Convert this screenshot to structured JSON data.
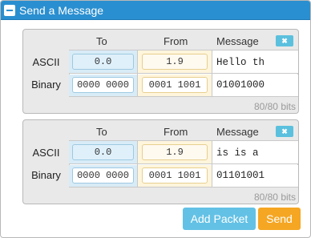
{
  "header": {
    "title": "Send a Message",
    "icon": "collapse-icon"
  },
  "columns": {
    "to": "To",
    "from": "From",
    "message": "Message"
  },
  "row_labels": {
    "ascii": "ASCII",
    "binary": "Binary"
  },
  "packets": [
    {
      "to_ascii": "0.0",
      "from_ascii": "1.9",
      "message_ascii": "Hello th",
      "to_binary": "0000 0000",
      "from_binary": "0001 1001",
      "message_binary": "01001000",
      "bits": "80/80 bits",
      "remove_label": "✖"
    },
    {
      "to_ascii": "0.0",
      "from_ascii": "1.9",
      "message_ascii": "is is a",
      "to_binary": "0000 0000",
      "from_binary": "0001 1001",
      "message_binary": "01101001",
      "bits": "80/80 bits",
      "remove_label": "✖"
    }
  ],
  "buttons": {
    "add_packet": "Add Packet",
    "send": "Send"
  },
  "colors": {
    "header": "#2a8fd0",
    "add_packet": "#63c1e5",
    "send": "#f5a623",
    "to_cell": "#d8ecf7",
    "from_cell": "#fef5dc"
  }
}
